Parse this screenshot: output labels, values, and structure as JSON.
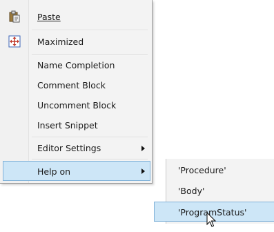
{
  "menu": {
    "items": [
      {
        "label": "Paste",
        "icon": "clipboard-paste-icon"
      },
      {
        "label": "Maximized",
        "icon": "maximize-arrows-icon"
      },
      {
        "label": "Name Completion"
      },
      {
        "label": "Comment Block"
      },
      {
        "label": "Uncomment Block"
      },
      {
        "label": "Insert Snippet"
      },
      {
        "label": "Editor Settings",
        "has_submenu": true
      },
      {
        "label": "Help on",
        "has_submenu": true,
        "state": "highlighted"
      }
    ]
  },
  "submenu": {
    "items": [
      {
        "label": "'Procedure'"
      },
      {
        "label": "'Body'"
      },
      {
        "label": "'ProgramStatus'",
        "state": "highlighted"
      }
    ]
  },
  "colors": {
    "menu_background": "#f3f3f3",
    "highlight_fill": "#cde6f7",
    "highlight_border": "#7fb1d8"
  },
  "cursor": "arrow-cursor-icon"
}
